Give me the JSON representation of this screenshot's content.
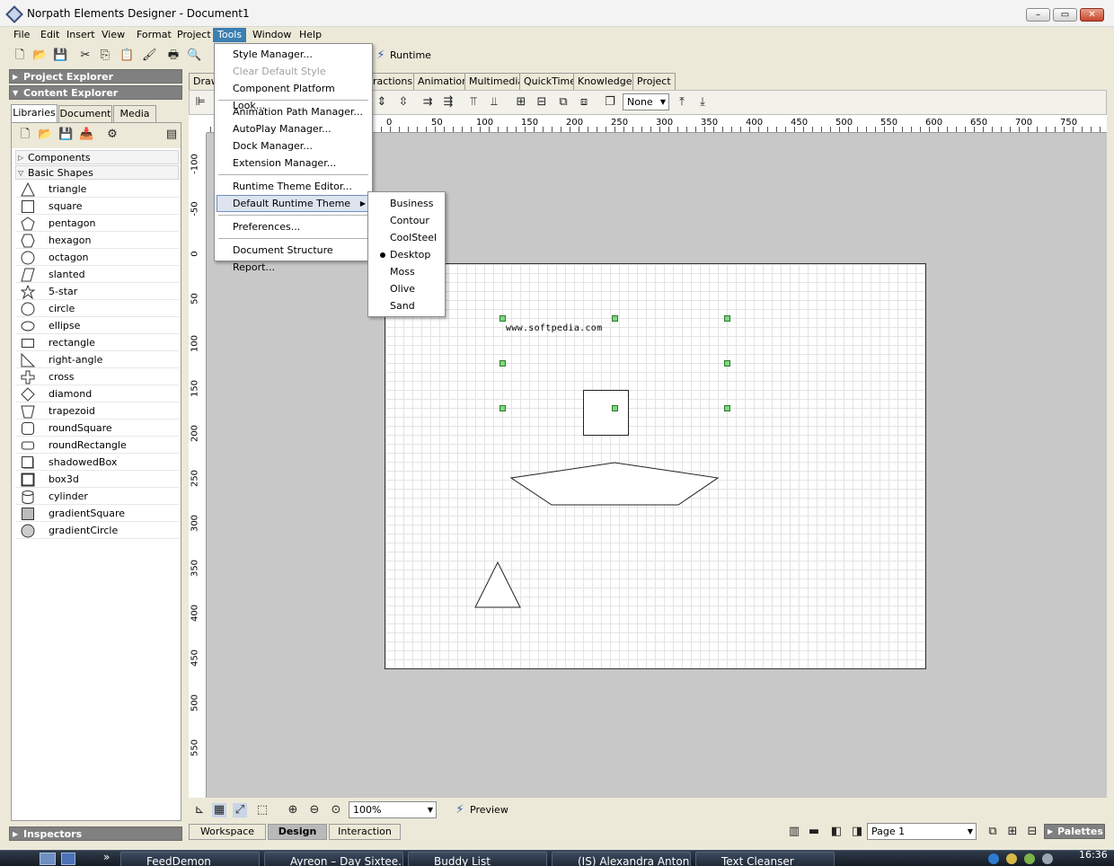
{
  "window": {
    "title": "Norpath Elements Designer - Document1",
    "minimize": "–",
    "maximize": "▭",
    "close": "✕"
  },
  "menubar": [
    "File",
    "Edit",
    "Insert",
    "View",
    "Format",
    "Project",
    "Tools",
    "Window",
    "Help"
  ],
  "toolbar": {
    "runtime_label": "Runtime"
  },
  "panels": {
    "project_explorer": "Project Explorer",
    "content_explorer": "Content Explorer",
    "inspectors": "Inspectors"
  },
  "library_tabs": [
    "Libraries",
    "Document",
    "Media"
  ],
  "library": {
    "components_group": "Components",
    "basic_shapes_group": "Basic Shapes",
    "shapes": [
      "triangle",
      "square",
      "pentagon",
      "hexagon",
      "octagon",
      "slanted",
      "5-star",
      "circle",
      "ellipse",
      "rectangle",
      "right-angle",
      "cross",
      "diamond",
      "trapezoid",
      "roundSquare",
      "roundRectangle",
      "shadowedBox",
      "box3d",
      "cylinder",
      "gradientSquare",
      "gradientCircle"
    ]
  },
  "doc_tabs": [
    "Draw",
    "ractions",
    "Animation",
    "Multimedia",
    "QuickTime",
    "Knowledge",
    "Project"
  ],
  "toolbar2": {
    "none_combo": "None"
  },
  "ruler": {
    "top": [
      "0",
      "50",
      "100",
      "150",
      "200",
      "250",
      "300",
      "350",
      "400",
      "450",
      "500",
      "550",
      "600",
      "650",
      "700",
      "750"
    ],
    "left": [
      "-100",
      "-50",
      "0",
      "50",
      "100",
      "150",
      "200",
      "250",
      "300",
      "350",
      "400",
      "450",
      "500",
      "550"
    ]
  },
  "canvas": {
    "text": "www.softpedia.com"
  },
  "tools_menu": {
    "items": [
      "Style Manager...",
      "Clear Default Style",
      "Component Platform Look...",
      "Animation Path Manager...",
      "AutoPlay Manager...",
      "Dock Manager...",
      "Extension Manager...",
      "Runtime Theme Editor...",
      "Default Runtime Theme",
      "Preferences...",
      "Document Structure Report..."
    ],
    "submenu_arrow": "▶"
  },
  "theme_menu": {
    "items": [
      "Business",
      "Contour",
      "CoolSteel",
      "Desktop",
      "Moss",
      "Olive",
      "Sand"
    ],
    "selected": "Desktop"
  },
  "viewbar": {
    "zoom": "100%",
    "preview": "Preview"
  },
  "modebar": {
    "buttons": [
      "Workspace",
      "Design",
      "Interaction"
    ],
    "active": "Design",
    "page": "Page 1",
    "palettes": "Palettes"
  },
  "taskbar": {
    "start_glyph": "»",
    "items": [
      "FeedDemon",
      "Ayreon – Day Sixtee...",
      "Buddy List",
      "(IS) Alexandra Anton",
      "Text Cleanser"
    ],
    "clock": "16:36"
  }
}
